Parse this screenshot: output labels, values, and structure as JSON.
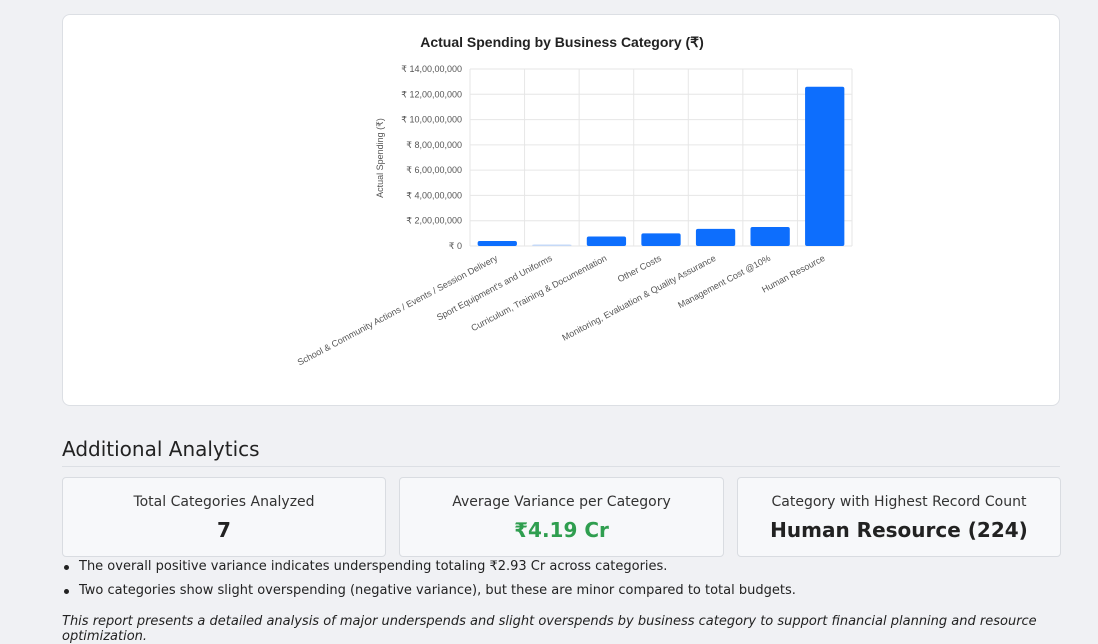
{
  "chart_data": {
    "type": "bar",
    "title": "Actual Spending by Business Category (₹)",
    "xlabel": "",
    "ylabel": "Actual Spending (₹)",
    "ylim": [
      0,
      140000000
    ],
    "yticks": [
      "₹ 0",
      "₹ 2,00,00,000",
      "₹ 4,00,00,000",
      "₹ 6,00,00,000",
      "₹ 8,00,00,000",
      "₹ 10,00,00,000",
      "₹ 12,00,00,000",
      "₹ 14,00,00,000"
    ],
    "categories": [
      "School & Community Actions / Events / Session Delivery",
      "Sport Equipment's and Uniforms",
      "Curriculum, Training & Documentation",
      "Other Costs",
      "Monitoring, Evaluation & Quality Assurance",
      "Management Cost @10%",
      "Human Resource"
    ],
    "values": [
      4000000,
      1000000,
      7500000,
      10000000,
      13500000,
      15000000,
      126000000
    ],
    "colors": [
      "#0d6efd",
      "#c5d9f7",
      "#0d6efd",
      "#0d6efd",
      "#0d6efd",
      "#0d6efd",
      "#0d6efd"
    ],
    "grid": true,
    "legend": "none"
  },
  "analytics": {
    "heading": "Additional Analytics",
    "cards": [
      {
        "label": "Total Categories Analyzed",
        "value": "7"
      },
      {
        "label": "Average Variance per Category",
        "value": "₹4.19 Cr"
      },
      {
        "label": "Category with Highest Record Count",
        "value": "Human Resource (224)"
      }
    ],
    "notes": [
      "The overall positive variance indicates underspending totaling ₹2.93 Cr across categories.",
      "Two categories show slight overspending (negative variance), but these are minor compared to total budgets."
    ],
    "footer": "This report presents a detailed analysis of major underspends and slight overspends by business category to support financial planning and resource optimization."
  },
  "colors": {
    "accent_bar": "#0d6efd",
    "highlight_value": "#2f9e4f"
  }
}
